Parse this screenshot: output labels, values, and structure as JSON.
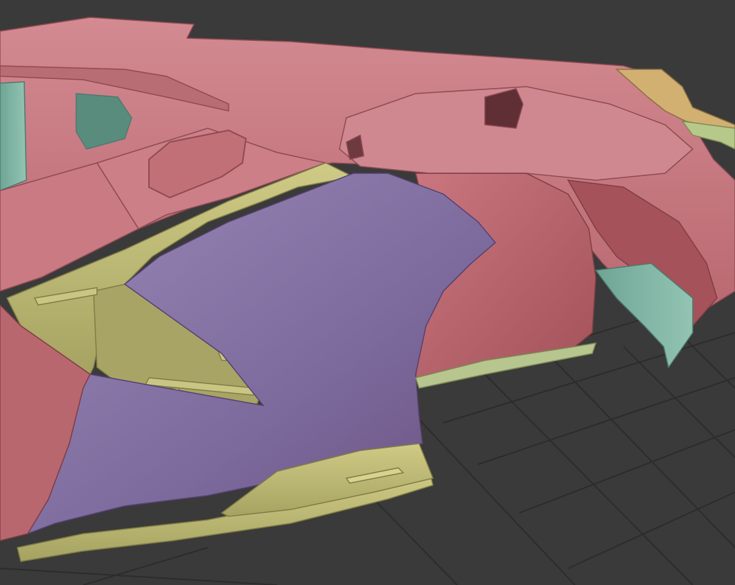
{
  "viewport": {
    "background": "#3a3a3a",
    "grid_color": "#2c2c2c",
    "grid": true
  },
  "model": {
    "material_colors": {
      "body_panel": "#c97a82",
      "body_panel_shadow": "#9b5058",
      "side_intake_panel": "#7c6a9c",
      "side_intake_highlight": "#9a88b8",
      "trim": "#c2bf7a",
      "trim_dark": "#8e8b4f",
      "interior": "#7fb3a3",
      "wing": "#d1b072"
    },
    "parts": [
      "roof",
      "rear-window",
      "engine-cover",
      "air-scoop",
      "side-window",
      "door",
      "door-handle-recess",
      "side-intake-panel",
      "intake-trim",
      "intake-vanes",
      "rear-fender",
      "rear-wheel-arch",
      "wheel-well-interior",
      "rear-wing",
      "side-skirt",
      "skirt-vent"
    ]
  }
}
